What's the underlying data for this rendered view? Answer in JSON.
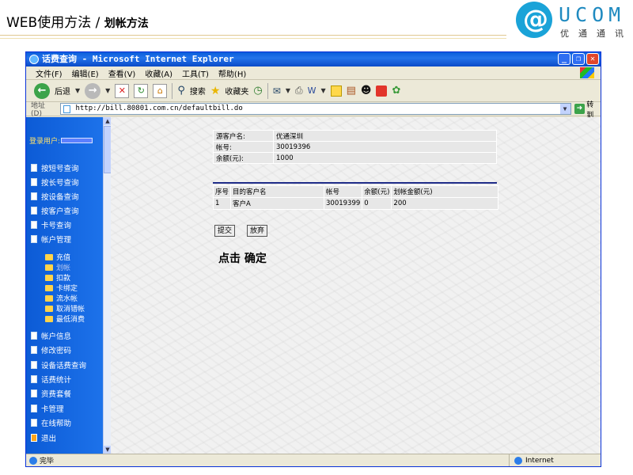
{
  "slide": {
    "title": "WEB使用方法 / ",
    "subtitle": "划帐方法",
    "logo_brand": "UCOM",
    "logo_cn": "优通通讯"
  },
  "window": {
    "title": "话费查询 - Microsoft Internet Explorer"
  },
  "menu": [
    "文件(F)",
    "编辑(E)",
    "查看(V)",
    "收藏(A)",
    "工具(T)",
    "帮助(H)"
  ],
  "toolbar": {
    "back": "后退",
    "search": "搜索",
    "favorites": "收藏夹"
  },
  "address": {
    "label": "地址(D)",
    "url": "http://bill.80801.com.cn/defaultbill.do",
    "go": "转到"
  },
  "sidebar": {
    "user_label": "登录用户:",
    "items_top": [
      "按短号查询",
      "按长号查询",
      "按设备查询",
      "按客户查询",
      "卡号查询",
      "帐户管理"
    ],
    "sub_items": [
      "充值",
      "划帐",
      "扣款",
      "卡绑定",
      "流水帐",
      "取消错帐",
      "最低消费"
    ],
    "items_bottom": [
      "帐户信息",
      "修改密码",
      "设备话费查询",
      "话费统计",
      "资费套餐",
      "卡管理",
      "在线帮助",
      "退出"
    ]
  },
  "info": [
    {
      "key": "源客户名:",
      "value": "优通深圳"
    },
    {
      "key": "帐号:",
      "value": "30019396"
    },
    {
      "key": "余额(元):",
      "value": "1000"
    }
  ],
  "detail": {
    "headers": [
      "序号",
      "目的客户名",
      "帐号",
      "余额(元)",
      "划帐金额(元)"
    ],
    "rows": [
      [
        "1",
        "客户A",
        "30019399",
        "0",
        "200"
      ]
    ]
  },
  "buttons": {
    "submit": "提交",
    "cancel": "放弃"
  },
  "note": "点击 确定",
  "status": {
    "left": "完毕",
    "zone": "Internet"
  }
}
